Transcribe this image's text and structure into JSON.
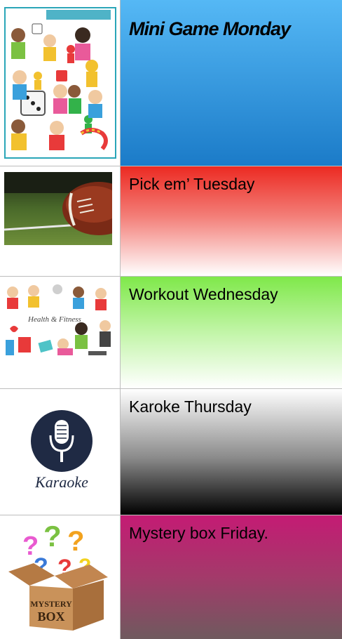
{
  "days": [
    {
      "label": "Mini Game Monday",
      "image": "board-game-kids-illustration",
      "colors": [
        "#55b8f5",
        "#1b7bc8"
      ]
    },
    {
      "label": "Pick em’ Tuesday",
      "image": "football-on-field-photo",
      "colors": [
        "#ec2a22",
        "#ffffff"
      ]
    },
    {
      "label": "Workout Wednesday",
      "image": "health-and-fitness-kids-illustration",
      "colors": [
        "#7fe84a",
        "#ffffff"
      ]
    },
    {
      "label": "Karoke Thursday",
      "image": "karaoke-microphone-logo",
      "colors": [
        "#ffffff",
        "#000000"
      ]
    },
    {
      "label": "Mystery box Friday.",
      "image": "mystery-box-illustration",
      "colors": [
        "#c41b74",
        "#6f5a5e"
      ]
    }
  ],
  "images": {
    "fitness_caption": "Health & Fitness",
    "karaoke_word": "Karaoke",
    "box_word_1": "MYSTERY",
    "box_word_2": "BOX"
  }
}
